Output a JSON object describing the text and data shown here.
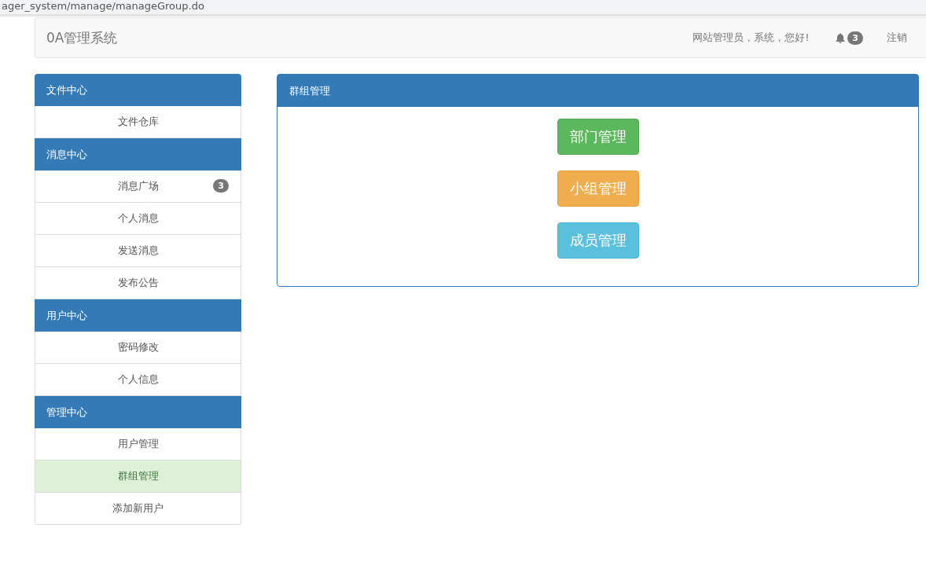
{
  "address_bar": {
    "url": "ager_system/manage/manageGroup.do"
  },
  "navbar": {
    "brand": "0A管理系统",
    "greeting": "网站管理员，系统，您好!",
    "notification_count": "3",
    "logout": "注销"
  },
  "sidebar": {
    "groups": [
      {
        "title": "文件中心",
        "items": [
          {
            "label": "文件仓库",
            "selected": false
          }
        ]
      },
      {
        "title": "消息中心",
        "items": [
          {
            "label": "消息广场",
            "selected": false,
            "badge": "3"
          },
          {
            "label": "个人消息",
            "selected": false
          },
          {
            "label": "发送消息",
            "selected": false
          },
          {
            "label": "发布公告",
            "selected": false
          }
        ]
      },
      {
        "title": "用户中心",
        "items": [
          {
            "label": "密码修改",
            "selected": false
          },
          {
            "label": "个人信息",
            "selected": false
          }
        ]
      },
      {
        "title": "管理中心",
        "items": [
          {
            "label": "用户管理",
            "selected": false
          },
          {
            "label": "群组管理",
            "selected": true
          },
          {
            "label": "添加新用户",
            "selected": false
          }
        ]
      }
    ]
  },
  "panel": {
    "title": "群组管理",
    "buttons": [
      {
        "label": "部门管理",
        "kind": "success"
      },
      {
        "label": "小组管理",
        "kind": "warning"
      },
      {
        "label": "成员管理",
        "kind": "info"
      }
    ]
  }
}
